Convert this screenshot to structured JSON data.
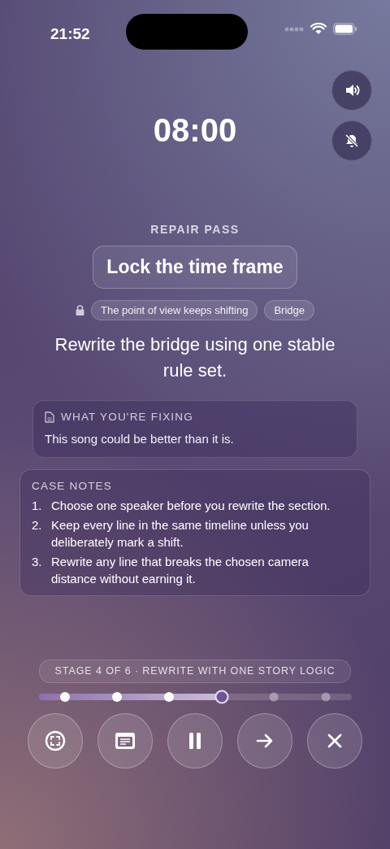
{
  "status_bar": {
    "time": "21:52"
  },
  "side_buttons": [
    {
      "kind": "sound"
    },
    {
      "kind": "bell-off"
    }
  ],
  "timer": "08:00",
  "eyebrow": "REPAIR PASS",
  "title": "Lock the time frame",
  "tags": {
    "locked": true,
    "items": [
      "The point of view keeps shifting",
      "Bridge"
    ]
  },
  "instruction": "Rewrite the bridge using one stable rule set.",
  "fixing": {
    "heading": "WHAT YOU'RE FIXING",
    "text": "This song could be better than it is."
  },
  "case_notes": {
    "heading": "CASE NOTES",
    "items": [
      {
        "number": "1.",
        "text": "Choose one speaker before you rewrite the section."
      },
      {
        "number": "2.",
        "text": "Keep every line in the same timeline unless you deliberately mark a shift."
      },
      {
        "number": "3.",
        "text": "Rewrite any line that breaks the chosen camera distance without earning it."
      }
    ]
  },
  "stage_label": "STAGE 4 OF 6 · REWRITE WITH ONE STORY LOGIC",
  "progress": {
    "level": 0.58,
    "stages": [
      {
        "completed": true,
        "selected": false
      },
      {
        "completed": true,
        "selected": false
      },
      {
        "completed": true,
        "selected": false
      },
      {
        "completed": false,
        "selected": true
      },
      {
        "completed": false,
        "selected": false
      },
      {
        "completed": false,
        "selected": false
      }
    ]
  },
  "controls": [
    {
      "kind": "focus"
    },
    {
      "kind": "notes"
    },
    {
      "kind": "pause"
    },
    {
      "kind": "next"
    },
    {
      "kind": "close"
    }
  ]
}
